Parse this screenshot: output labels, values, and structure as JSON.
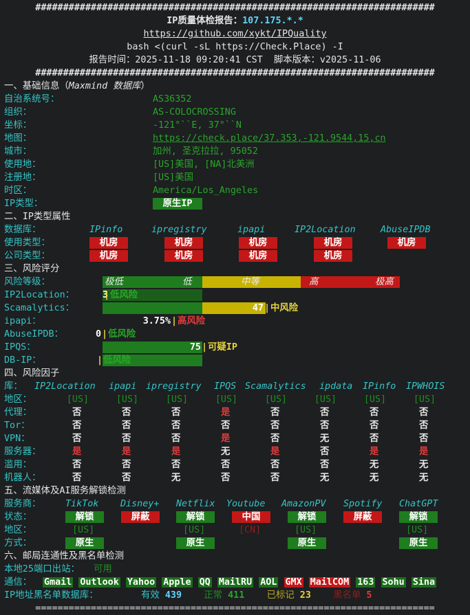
{
  "header": {
    "border": "########################################################################",
    "title_prefix": "IP质量体检报告：",
    "title_ip": "107.175.*.*",
    "repo": "https://github.com/xykt/IPQuality",
    "command": "bash <(curl -sL https://Check.Place) -I",
    "report_time": "报告时间：2025-11-18 09:20:41 CST  脚本版本：v2025-11-06"
  },
  "section1": {
    "title": "一、基础信息（",
    "title_it": "Maxmind 数据库",
    "title_end": "）",
    "rows": [
      {
        "label": "自治系统号：",
        "value": "AS36352"
      },
      {
        "label": "组织：",
        "value": "AS-COLOCROSSING"
      },
      {
        "label": "坐标：",
        "value": "-121°``E, 37°``N"
      },
      {
        "label": "地图：",
        "value": "https://check.place/37.353,-121.9544,15,cn"
      },
      {
        "label": "城市：",
        "value": "加州, 圣克拉拉, 95052"
      },
      {
        "label": "使用地：",
        "value": "[US]美国, [NA]北美洲"
      },
      {
        "label": "注册地：",
        "value": "[US]美国"
      },
      {
        "label": "时区：",
        "value": "America/Los_Angeles"
      }
    ],
    "ip_type_label": "IP类型：",
    "ip_type_value": "原生IP"
  },
  "section2": {
    "title": "二、IP类型属性",
    "db_label": "数据库：",
    "dbs": [
      "IPinfo",
      "ipregistry",
      "ipapi",
      "IP2Location",
      "AbuseIPDB"
    ],
    "usage_label": "使用类型：",
    "usage": [
      "机房",
      "机房",
      "机房",
      "机房",
      "机房"
    ],
    "company_label": "公司类型：",
    "company": [
      "机房",
      "机房",
      "机房",
      "机房"
    ]
  },
  "section3": {
    "title": "三、风险评分",
    "level_label": "风险等级：",
    "levels": [
      "极低",
      "低",
      "中等",
      "高",
      "极高"
    ],
    "items": [
      {
        "label": "IP2Location：",
        "score": "3",
        "text": "低风险"
      },
      {
        "label": "Scamalytics：",
        "score": "47",
        "text": "中风险"
      },
      {
        "label": "ipapi：",
        "score": "3.75%",
        "text": "高风险"
      },
      {
        "label": "AbuseIPDB：",
        "score": "0",
        "text": "低风险"
      },
      {
        "label": "IPQS：",
        "score": "75",
        "text": "可疑IP"
      },
      {
        "label": "DB-IP：",
        "score": "",
        "text": "低风险"
      }
    ],
    "colors": {
      "green": "#1f7d1f",
      "yellow": "#c8b400",
      "red": "#c41818"
    }
  },
  "section4": {
    "title": "四、风险因子",
    "db_label": "库：",
    "dbs": [
      "IP2Location",
      "ipapi",
      "ipregistry",
      "IPQS",
      "Scamalytics",
      "ipdata",
      "IPinfo",
      "IPWHOIS"
    ],
    "region_label": "地区：",
    "regions": [
      "[US]",
      "[US]",
      "[US]",
      "[US]",
      "[US]",
      "[US]",
      "[US]",
      "[US]"
    ],
    "rows": [
      {
        "label": "代理：",
        "vals": [
          "否",
          "否",
          "否",
          "是",
          "否",
          "否",
          "否",
          "否"
        ]
      },
      {
        "label": "Tor：",
        "vals": [
          "否",
          "否",
          "否",
          "否",
          "否",
          "否",
          "否",
          "否"
        ]
      },
      {
        "label": "VPN：",
        "vals": [
          "否",
          "否",
          "否",
          "是",
          "否",
          "无",
          "否",
          "否"
        ]
      },
      {
        "label": "服务器：",
        "vals": [
          "是",
          "是",
          "是",
          "无",
          "是",
          "否",
          "是",
          "是"
        ]
      },
      {
        "label": "滥用：",
        "vals": [
          "否",
          "否",
          "否",
          "否",
          "否",
          "否",
          "无",
          "无"
        ]
      },
      {
        "label": "机器人：",
        "vals": [
          "否",
          "否",
          "无",
          "否",
          "否",
          "无",
          "无",
          "无"
        ]
      }
    ]
  },
  "section5": {
    "title": "五、流媒体及AI服务解锁检测",
    "svc_label": "服务商：",
    "services": [
      "TikTok",
      "Disney+",
      "Netflix",
      "Youtube",
      "AmazonPV",
      "Spotify",
      "ChatGPT"
    ],
    "status_label": "状态：",
    "status": [
      "解锁",
      "屏蔽",
      "解锁",
      "中国",
      "解锁",
      "屏蔽",
      "解锁"
    ],
    "region_label": "地区：",
    "regions": [
      "[US]",
      "",
      "[US]",
      "[CN]",
      "[US]",
      "",
      "[US]"
    ],
    "method_label": "方式：",
    "methods": [
      "原生",
      "",
      "原生",
      "",
      "原生",
      "",
      "原生"
    ]
  },
  "section6": {
    "title": "六、邮局连通性及黑名单检测",
    "port25_label": "本地25端口出站：",
    "port25_value": "可用",
    "mail_label": "通信：",
    "mails": [
      "Gmail",
      "Outlook",
      "Yahoo",
      "Apple",
      "QQ",
      "MailRU",
      "AOL",
      "GMX",
      "MailCOM",
      "163",
      "Sohu",
      "Sina"
    ],
    "blacklist_label": "IP地址黑名单数据库：",
    "valid_label": "有效",
    "valid_value": "439",
    "normal_label": "正常",
    "normal_value": "411",
    "marked_label": "已标记",
    "marked_value": "23",
    "black_label": "黑名单",
    "black_value": "5"
  },
  "footer": {
    "border": "========================================================================"
  }
}
